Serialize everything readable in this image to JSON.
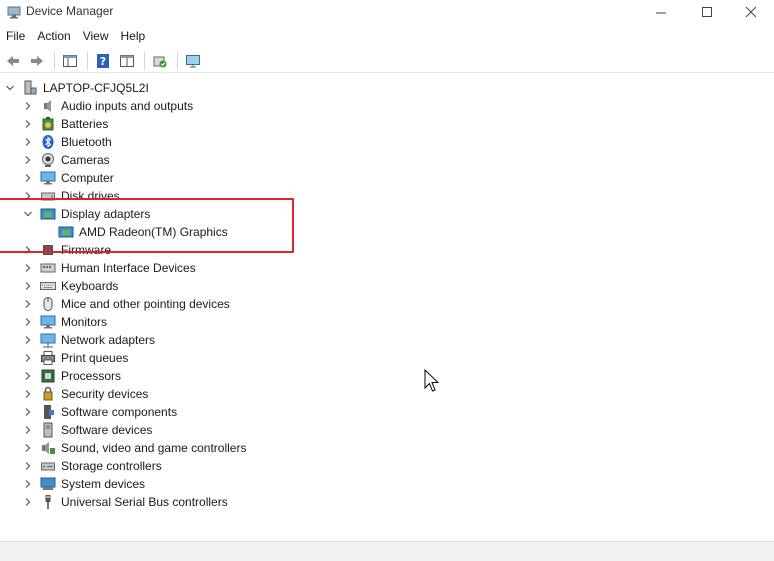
{
  "window": {
    "title": "Device Manager"
  },
  "menu": [
    "File",
    "Action",
    "View",
    "Help"
  ],
  "toolbar": {
    "buttons": [
      "back-icon",
      "forward-icon",
      "properties-pane-icon",
      "help-icon",
      "view-icon",
      "scan-icon",
      "monitor-icon"
    ]
  },
  "tree": {
    "root": "LAPTOP-CFJQ5L2I",
    "categories": [
      {
        "label": "Audio inputs and outputs",
        "icon": "speaker-icon",
        "expanded": false
      },
      {
        "label": "Batteries",
        "icon": "battery-icon",
        "expanded": false
      },
      {
        "label": "Bluetooth",
        "icon": "bluetooth-icon",
        "expanded": false
      },
      {
        "label": "Cameras",
        "icon": "camera-icon",
        "expanded": false
      },
      {
        "label": "Computer",
        "icon": "computer-icon",
        "expanded": false
      },
      {
        "label": "Disk drives",
        "icon": "disk-icon",
        "expanded": false
      },
      {
        "label": "Display adapters",
        "icon": "display-adapter-icon",
        "expanded": true,
        "children": [
          "AMD Radeon(TM) Graphics"
        ]
      },
      {
        "label": "Firmware",
        "icon": "firmware-icon",
        "expanded": false
      },
      {
        "label": "Human Interface Devices",
        "icon": "hid-icon",
        "expanded": false
      },
      {
        "label": "Keyboards",
        "icon": "keyboard-icon",
        "expanded": false
      },
      {
        "label": "Mice and other pointing devices",
        "icon": "mouse-icon",
        "expanded": false
      },
      {
        "label": "Monitors",
        "icon": "monitor-icon",
        "expanded": false
      },
      {
        "label": "Network adapters",
        "icon": "network-icon",
        "expanded": false
      },
      {
        "label": "Print queues",
        "icon": "printer-icon",
        "expanded": false
      },
      {
        "label": "Processors",
        "icon": "processor-icon",
        "expanded": false
      },
      {
        "label": "Security devices",
        "icon": "security-icon",
        "expanded": false
      },
      {
        "label": "Software components",
        "icon": "software-component-icon",
        "expanded": false
      },
      {
        "label": "Software devices",
        "icon": "software-device-icon",
        "expanded": false
      },
      {
        "label": "Sound, video and game controllers",
        "icon": "sound-icon",
        "expanded": false
      },
      {
        "label": "Storage controllers",
        "icon": "storage-icon",
        "expanded": false
      },
      {
        "label": "System devices",
        "icon": "system-icon",
        "expanded": false
      },
      {
        "label": "Universal Serial Bus controllers",
        "icon": "usb-icon",
        "expanded": false
      }
    ]
  },
  "colors": {
    "highlight": "#d7262e",
    "accent": "#0078d4"
  }
}
